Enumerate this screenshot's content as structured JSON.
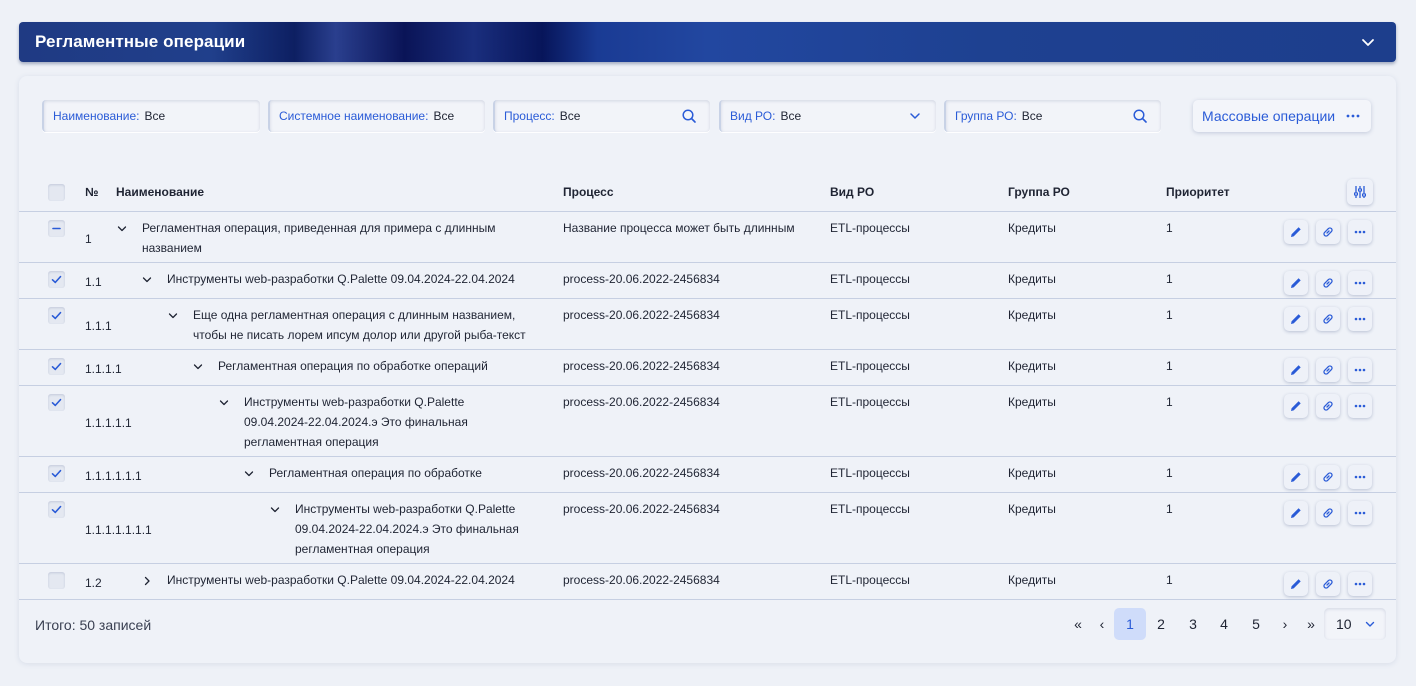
{
  "header": {
    "title": "Регламентные операции"
  },
  "filters": [
    {
      "label": "Наименование:",
      "value": "Все"
    },
    {
      "label": "Системное наименование:",
      "value": "Все"
    },
    {
      "label": "Процесс:",
      "value": "Все"
    },
    {
      "label": "Вид РО:",
      "value": "Все"
    },
    {
      "label": "Группа РО:",
      "value": "Все"
    }
  ],
  "mass_operations_label": "Массовые операции",
  "table": {
    "columns": {
      "num": "№",
      "name": "Наименование",
      "process": "Процесс",
      "type": "Вид РО",
      "group": "Группа РО",
      "priority": "Приоритет"
    },
    "rows": [
      {
        "num": "1",
        "checkbox": "indeterminate",
        "expanded": true,
        "name_lines": [
          "Регламентная операция, приведенная для примера с длинным",
          "названием"
        ],
        "process": "Название процесса может быть длинным",
        "type": "ETL-процессы",
        "group": "Кредиты",
        "priority": "1"
      },
      {
        "num": "1.1",
        "checkbox": "checked",
        "expanded": true,
        "name_lines": [
          "Инструменты web-разработки Q.Palette 09.04.2024-22.04.2024"
        ],
        "process": "process-20.06.2022-2456834",
        "type": "ETL-процессы",
        "group": "Кредиты",
        "priority": "1"
      },
      {
        "num": "1.1.1",
        "checkbox": "checked",
        "expanded": true,
        "name_lines": [
          "Еще одна регламентная операция с длинным названием,",
          "чтобы не писать лорем ипсум долор или другой рыба-текст"
        ],
        "process": "process-20.06.2022-2456834",
        "type": "ETL-процессы",
        "group": "Кредиты",
        "priority": "1"
      },
      {
        "num": "1.1.1.1",
        "checkbox": "checked",
        "expanded": true,
        "name_lines": [
          "Регламентная операция по обработке операций"
        ],
        "process": "process-20.06.2022-2456834",
        "type": "ETL-процессы",
        "group": "Кредиты",
        "priority": "1"
      },
      {
        "num": "1.1.1.1.1",
        "checkbox": "checked",
        "expanded": true,
        "name_lines": [
          "Инструменты web-разработки Q.Palette",
          "09.04.2024-22.04.2024.э Это финальная",
          "регламентная операция"
        ],
        "process": "process-20.06.2022-2456834",
        "type": "ETL-процессы",
        "group": "Кредиты",
        "priority": "1"
      },
      {
        "num": "1.1.1.1.1.1",
        "checkbox": "checked",
        "expanded": true,
        "name_lines": [
          "Регламентная операция по обработке"
        ],
        "process": "process-20.06.2022-2456834",
        "type": "ETL-процессы",
        "group": "Кредиты",
        "priority": "1"
      },
      {
        "num": "1.1.1.1.1.1.1",
        "checkbox": "checked",
        "expanded": true,
        "name_lines": [
          "Инструменты web-разработки Q.Palette",
          "09.04.2024-22.04.2024.э Это финальная",
          "регламентная операция"
        ],
        "process": "process-20.06.2022-2456834",
        "type": "ETL-процессы",
        "group": "Кредиты",
        "priority": "1"
      },
      {
        "num": "1.2",
        "checkbox": "unchecked",
        "expanded": false,
        "name_lines": [
          "Инструменты web-разработки Q.Palette 09.04.2024-22.04.2024"
        ],
        "process": "process-20.06.2022-2456834",
        "type": "ETL-процессы",
        "group": "Кредиты",
        "priority": "1"
      }
    ]
  },
  "footer": {
    "total": "Итого: 50 записей",
    "first": "«",
    "prev": "‹",
    "pages": [
      "1",
      "2",
      "3",
      "4",
      "5"
    ],
    "active_page": "1",
    "next": "›",
    "last": "»",
    "page_size": "10"
  },
  "colors": {
    "accent": "#2a5bd7",
    "header_bg": "#1d3e8c",
    "active_page_bg": "#cfdcfa"
  },
  "icons": {
    "header_toggle": "chevron-down-icon",
    "search": "search-icon",
    "dropdown": "chevron-down-icon",
    "more": "more-dots-icon",
    "settings": "column-settings-icon",
    "edit": "pencil-icon",
    "link": "link-icon"
  }
}
